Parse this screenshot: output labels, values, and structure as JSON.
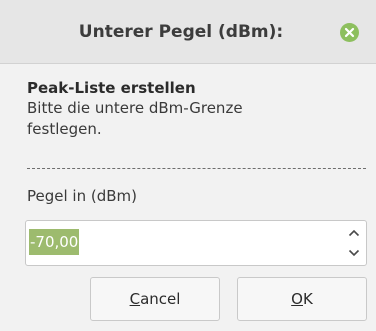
{
  "dialog": {
    "title": "Unterer Pegel (dBm):",
    "close_icon": "close-icon",
    "accent_color": "#8dbf5e",
    "heading": "Peak-Liste erstellen",
    "description": "Bitte die untere dBm-Grenze festlegen.",
    "field_label": "Pegel in (dBm)",
    "field_value": "-70,00",
    "selection_color": "#9dbb6e",
    "buttons": {
      "cancel": "Cancel",
      "ok": "OK"
    }
  }
}
